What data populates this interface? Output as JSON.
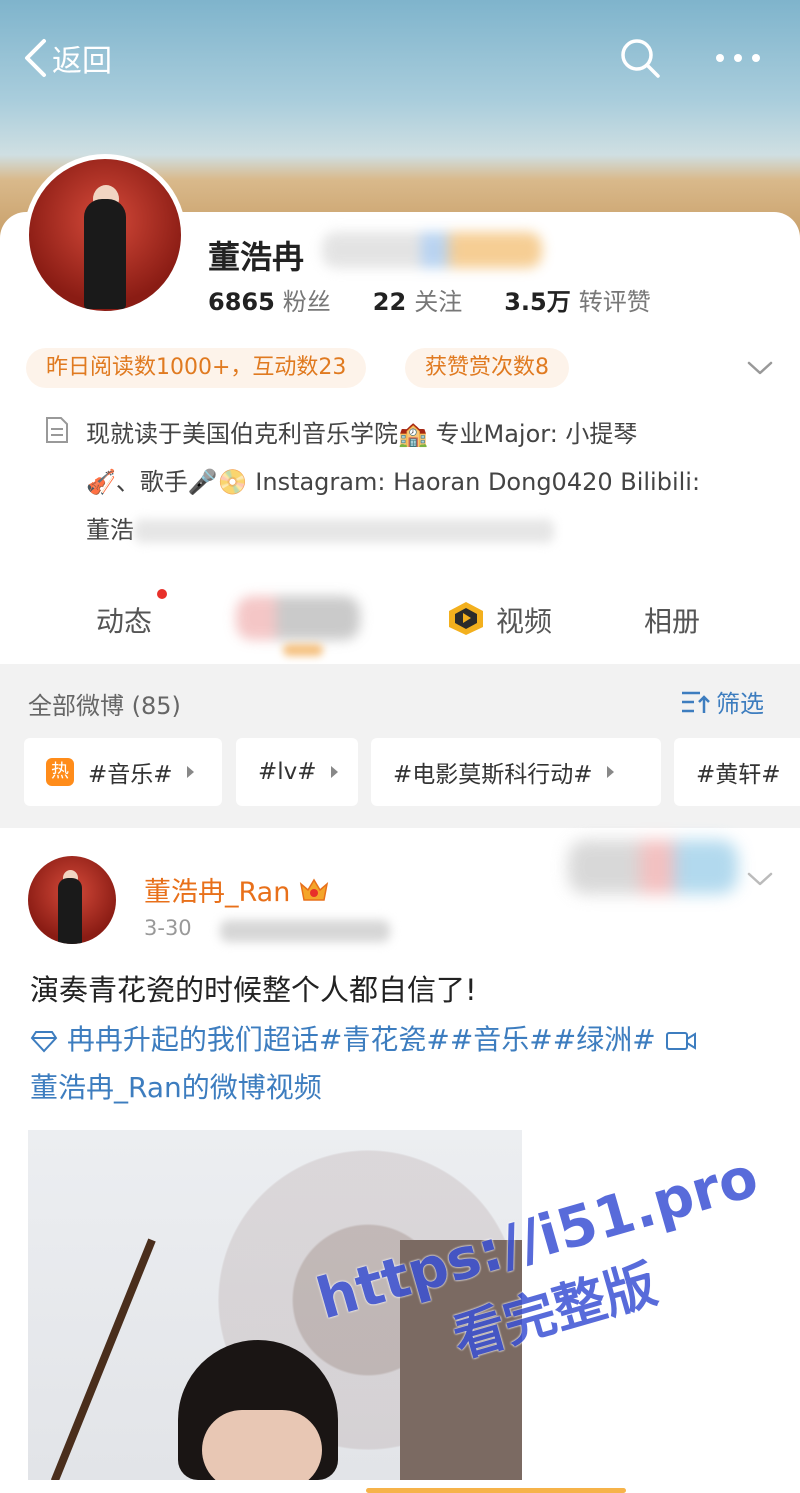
{
  "topbar": {
    "back_label": "返回"
  },
  "profile": {
    "name": "董浩冉",
    "stats": [
      {
        "num": "6865",
        "label": "粉丝"
      },
      {
        "num": "22",
        "label": "关注"
      },
      {
        "num": "3.5万",
        "label": "转评赞"
      }
    ],
    "pills": [
      "昨日阅读数1000+，互动数23",
      "获赞赏次数8"
    ],
    "bio_lines": [
      "现就读于美国伯克利音乐学院🏫 专业Major: 小提琴",
      "🎻、歌手🎤📀 Instagram: Haoran Dong0420 Bilibili:",
      "董浩"
    ]
  },
  "tabs": [
    "动态",
    "视频",
    "相册"
  ],
  "feed": {
    "count_label": "全部微博 (85)",
    "filter_label": "筛选",
    "hot_badge": "热",
    "topics": [
      "#音乐#",
      "#lv#",
      "#电影莫斯科行动#",
      "#黄轩#"
    ]
  },
  "post": {
    "author": "董浩冉_Ran",
    "date": "3-30",
    "text": "演奏青花瓷的时候整个人都自信了!",
    "topics_line": "冉冉升起的我们超话#青花瓷##音乐##绿洲#",
    "video_link": "董浩冉_Ran的微博视频"
  },
  "watermark": {
    "url": "https://i51.pro",
    "cn": "看完整版"
  },
  "colors": {
    "accent_orange": "#e8701a",
    "link_blue": "#3d7dbf",
    "pill_bg": "#fdf3ea"
  }
}
